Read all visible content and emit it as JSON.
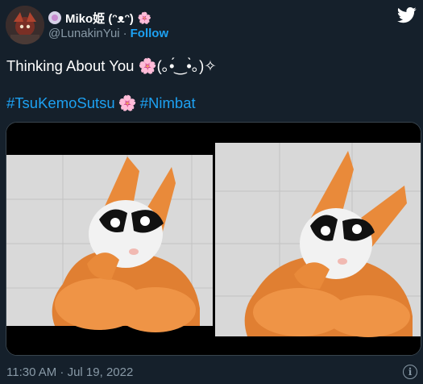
{
  "author": {
    "display_name": "Miko姫 (ᵔᴥᵔ)",
    "name_emoji": "🌸",
    "handle": "@LunakinYui",
    "separator": "·",
    "follow_label": "Follow"
  },
  "tweet": {
    "text": "Thinking About You 🌸(｡•́‿•̀｡)✧",
    "hashtags": [
      "#TsuKemoSutsu",
      "#Nimbat"
    ],
    "hashtag_separator": "🌸",
    "timestamp": "11:30 AM · Jul 19, 2022"
  },
  "media": {
    "count": 2,
    "icons": [
      "photo-left",
      "photo-right"
    ]
  },
  "colors": {
    "background": "#15202b",
    "link": "#1da1f2",
    "muted": "#8899a6",
    "suit_orange": "#e98a3a"
  }
}
